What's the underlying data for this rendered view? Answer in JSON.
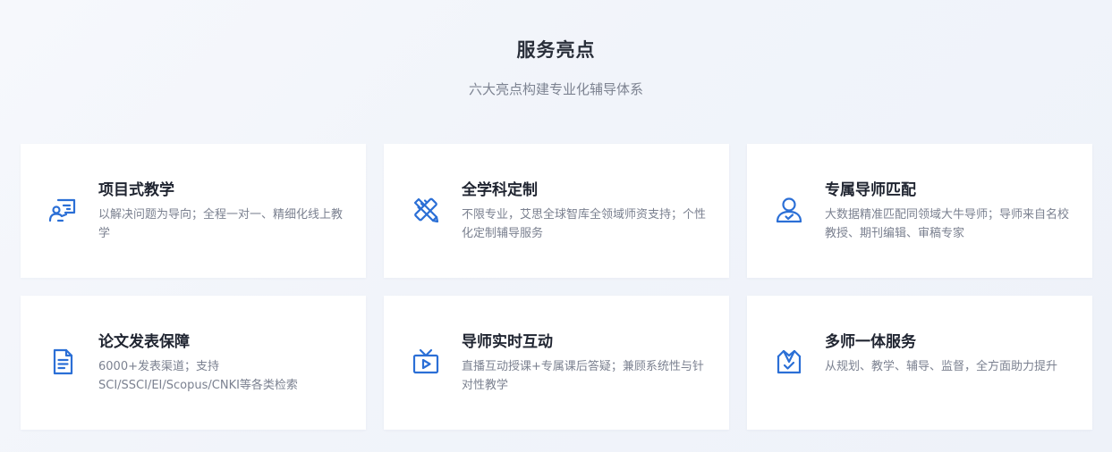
{
  "header": {
    "title": "服务亮点",
    "subtitle": "六大亮点构建专业化辅导体系"
  },
  "colors": {
    "accent": "#2b6fd6",
    "title": "#1f2430",
    "desc": "#7b8190"
  },
  "cards": [
    {
      "icon": "presentation-teacher-icon",
      "title": "项目式教学",
      "desc": "以解决问题为导向；全程一对一、精细化线上教学"
    },
    {
      "icon": "pencil-ruler-icon",
      "title": "全学科定制",
      "desc": "不限专业，艾思全球智库全领域师资支持；个性化定制辅导服务"
    },
    {
      "icon": "user-check-icon",
      "title": "专属导师匹配",
      "desc": "大数据精准匹配同领域大牛导师；导师来自名校教授、期刊编辑、审稿专家"
    },
    {
      "icon": "document-icon",
      "title": "论文发表保障",
      "desc": "6000+发表渠道；支持SCI/SSCI/EI/Scopus/CNKI等各类检索"
    },
    {
      "icon": "tv-play-icon",
      "title": "导师实时互动",
      "desc": "直播互动授课+专属课后答疑；兼顾系统性与针对性教学"
    },
    {
      "icon": "team-badge-icon",
      "title": "多师一体服务",
      "desc": "从规划、教学、辅导、监督，全方面助力提升"
    }
  ]
}
